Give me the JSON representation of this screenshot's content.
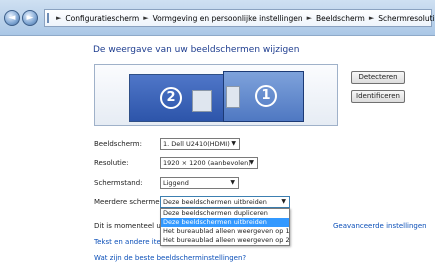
{
  "breadcrumb": {
    "items": [
      "Configuratiescherm",
      "Vormgeving en persoonlijke instellingen",
      "Beeldscherm",
      "Schermresolutie"
    ],
    "separator": "►"
  },
  "icons": {
    "back": "◄",
    "forward": "►"
  },
  "page": {
    "title": "De weergave van uw beeldschermen wijzigen"
  },
  "monitors": [
    {
      "number": "2"
    },
    {
      "number": "1"
    }
  ],
  "buttons": {
    "detect": "Detecteren",
    "identify": "Identificeren"
  },
  "settings": {
    "display": {
      "label": "Beeldscherm:",
      "value": "1. Dell U2410(HDMI)"
    },
    "resolution": {
      "label": "Resolutie:",
      "value": "1920 × 1200 (aanbevolen)"
    },
    "orientation": {
      "label": "Schermstand:",
      "value": "Liggend"
    },
    "multiple": {
      "label": "Meerdere schermen:",
      "value": "Deze beeldschermen uitbreiden"
    }
  },
  "dropdown_options": [
    "Deze beeldschermen dupliceren",
    "Deze beeldschermen uitbreiden",
    "Het bureaublad alleen weergeven op 1",
    "Het bureaublad alleen weergeven op 2"
  ],
  "main_display_text": "Dit is momenteel uw h",
  "advanced_link": "Geavanceerde instellingen",
  "links": {
    "text_items": "Tekst en andere items g",
    "best_settings": "Wat zijn de beste beeldscherminstellingen?"
  }
}
